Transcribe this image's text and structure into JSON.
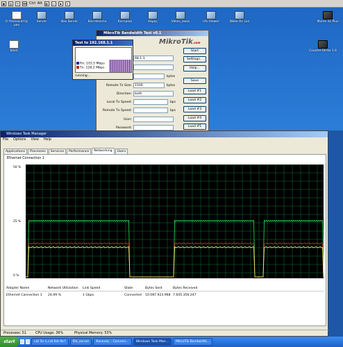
{
  "toolbar": {
    "ctrl_label": "Ctrl",
    "alt_label": "Alt"
  },
  "desktop_icons": [
    {
      "label": "Ο Υπολογιστής μου",
      "kind": "doc"
    },
    {
      "label": "Server",
      "kind": "pc"
    },
    {
      "label": "Nas Server",
      "kind": "pc"
    },
    {
      "label": "Κουτσεύντα",
      "kind": "pc"
    },
    {
      "label": "Κατερίνα",
      "kind": "pc"
    },
    {
      "label": "Χάρης",
      "kind": "pc"
    },
    {
      "label": "Vatsis_laxos",
      "kind": "pc"
    },
    {
      "label": "Irfc Viewer",
      "kind": "pc"
    },
    {
      "label": "Wake On Lan",
      "kind": "pc"
    },
    {
      "label": "Mame 32 Plus",
      "kind": "game"
    },
    {
      "label": "blast",
      "kind": "doc"
    },
    {
      "label": "Counter-Strike 1.6",
      "kind": "game"
    }
  ],
  "mikrotik": {
    "title": "MikroTik Bandwidth Test v0.1",
    "logo": "MikroTik",
    "logo_sub": ".com",
    "address_value": "68.1.1",
    "tx_size_label": "Remote Tx Size:",
    "tx_size_value": "1500",
    "tx_size_unit": "bytes",
    "size_unit_top": "bytes",
    "direction_label": "Direction:",
    "direction_value": "both",
    "local_tx_label": "Local Tx Speed:",
    "local_tx_unit": "bps",
    "remote_tx_label": "Remote Tx Speed:",
    "remote_tx_unit": "bps",
    "user_label": "User:",
    "password_label": "Password:",
    "buttons": [
      "Start",
      "Settings...",
      "Help...",
      "Save",
      "Load #1",
      "Load #2",
      "Load #3",
      "Load #4",
      "Load #5"
    ]
  },
  "test_window": {
    "title": "Test to 192.168.1.1",
    "rx_label": "Rx: 103.5 Mbps",
    "tx_label": "Tx: 128.2 Mbps",
    "status": "running...",
    "rx_color": "#1f1fa8",
    "tx_color": "#c81f1f"
  },
  "task_manager": {
    "title": "Windows Task Manager",
    "menu": [
      "File",
      "Options",
      "View",
      "Help"
    ],
    "tabs": [
      "Applications",
      "Processes",
      "Services",
      "Performance",
      "Networking",
      "Users"
    ],
    "active_tab": "Networking",
    "connection_title": "Ethernet Connection 1",
    "axis_labels": [
      "50 %",
      "25 %",
      "0 %"
    ],
    "columns": [
      "Adapter Name",
      "Network Utilization",
      "Link Speed",
      "State",
      "Bytes Sent",
      "Bytes Received"
    ],
    "row": [
      "Ethernet Connection 1",
      "24,99 %",
      "1 Gbps",
      "Connected",
      "10.087.923.968",
      "7.645.356.247"
    ],
    "status": {
      "processes": "Processes: 51",
      "cpu": "CPU Usage: 36%",
      "memory": "Physical Memory: 53%"
    }
  },
  "taskbar": {
    "start_label": "start",
    "items": [
      "cat 5e η cat 6st 6e?",
      "file_server",
      "Κουκνάς - Convers...",
      "Windows Task Man...",
      "MikroTik Bandwidth..."
    ],
    "active_index": 3
  },
  "colors": {
    "graph_bg": "#000000",
    "grid": "#0a7a3a",
    "sent": "#ffff66",
    "received": "#dd3333",
    "total": "#33dd55"
  }
}
